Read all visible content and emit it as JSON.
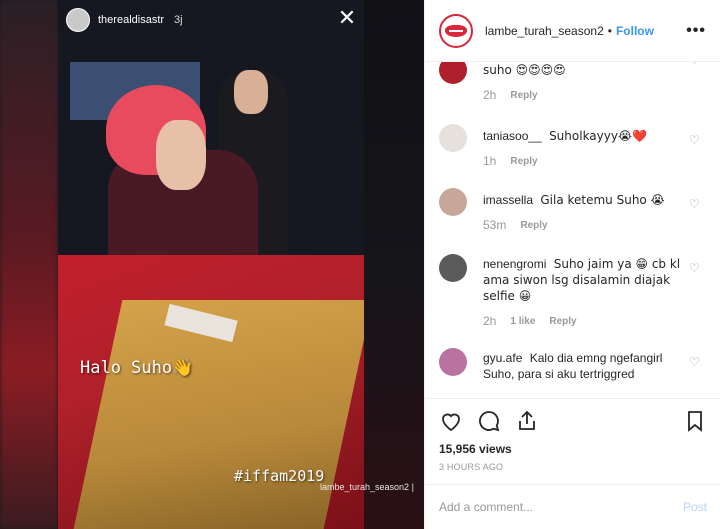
{
  "story": {
    "username": "therealdisastr",
    "time": "3j",
    "close_icon": "close-icon",
    "caption_text": "Halo Suho",
    "caption_emoji": "👋",
    "hashtag": "#iffam2019",
    "watermark": "lambe_turah_season2 |"
  },
  "header": {
    "account": "lambe_turah_season2",
    "separator": "•",
    "follow_label": "Follow",
    "more_label": "•••",
    "brand_color": "#d8263a",
    "follow_color": "#3897f0"
  },
  "comments": [
    {
      "user": "",
      "text": "suho 😍😍😍😍",
      "time": "2h",
      "likes": "",
      "reply": "Reply"
    },
    {
      "user": "taniasoo__",
      "text": "Suholkayyy😭❤️",
      "time": "1h",
      "likes": "",
      "reply": "Reply"
    },
    {
      "user": "imassella",
      "text": "Gila ketemu Suho 😭",
      "time": "53m",
      "likes": "",
      "reply": "Reply"
    },
    {
      "user": "nenengromi",
      "text": "Suho jaim ya 😁 cb kl ama siwon lsg disalamin diajak selfie 😀",
      "time": "2h",
      "likes": "1 like",
      "reply": "Reply"
    },
    {
      "user": "gyu.afe",
      "text": "Kalo dia emng ngefangirl Suho, para si aku tertriggred",
      "time": "",
      "likes": "",
      "reply": ""
    }
  ],
  "actions": {
    "views": "15,956 views",
    "posted": "3 HOURS AGO"
  },
  "add_comment": {
    "placeholder": "Add a comment...",
    "post_label": "Post"
  }
}
